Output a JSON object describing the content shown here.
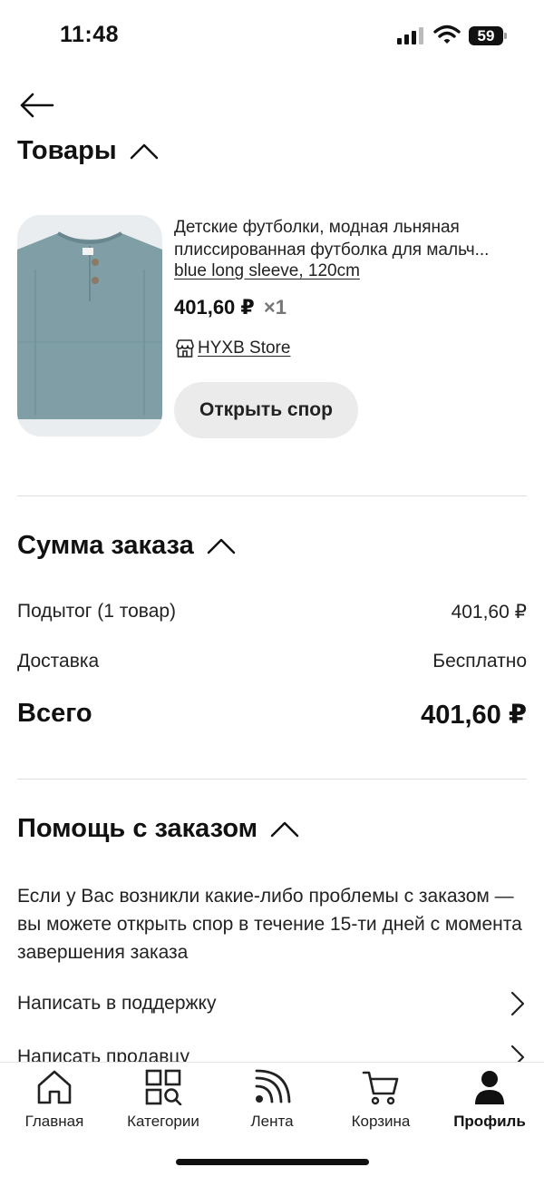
{
  "status_bar": {
    "time": "11:48",
    "battery": "59"
  },
  "products_section": {
    "title": "Товары"
  },
  "product": {
    "title_line1": "Детские футболки, модная льняная",
    "title_line2": "плиссированная футболка для мальч...",
    "variant": "blue long sleeve, 120cm",
    "price": "401,60 ₽",
    "quantity": "×1",
    "store": "HYXB Store",
    "dispute_button": "Открыть спор"
  },
  "summary_section": {
    "title": "Сумма заказа",
    "subtotal_label": "Подытог (1 товар)",
    "subtotal_value": "401,60 ₽",
    "delivery_label": "Доставка",
    "delivery_value": "Бесплатно",
    "total_label": "Всего",
    "total_value": "401,60 ₽"
  },
  "help_section": {
    "title": "Помощь с заказом",
    "text": "Если у Вас возникли какие-либо проблемы с заказом — вы можете открыть спор в течение 15-ти дней с момента завершения заказа",
    "links": [
      "Написать в поддержку",
      "Написать продавцу"
    ]
  },
  "tab_bar": {
    "items": [
      {
        "label": "Главная",
        "icon": "home-icon"
      },
      {
        "label": "Категории",
        "icon": "categories-icon"
      },
      {
        "label": "Лента",
        "icon": "feed-icon"
      },
      {
        "label": "Корзина",
        "icon": "cart-icon"
      },
      {
        "label": "Профиль",
        "icon": "profile-icon",
        "active": true
      }
    ]
  },
  "colors": {
    "text": "#111111",
    "divider": "#dedede",
    "button_bg": "#ebebeb",
    "product_shirt": "#7f9ea6"
  }
}
